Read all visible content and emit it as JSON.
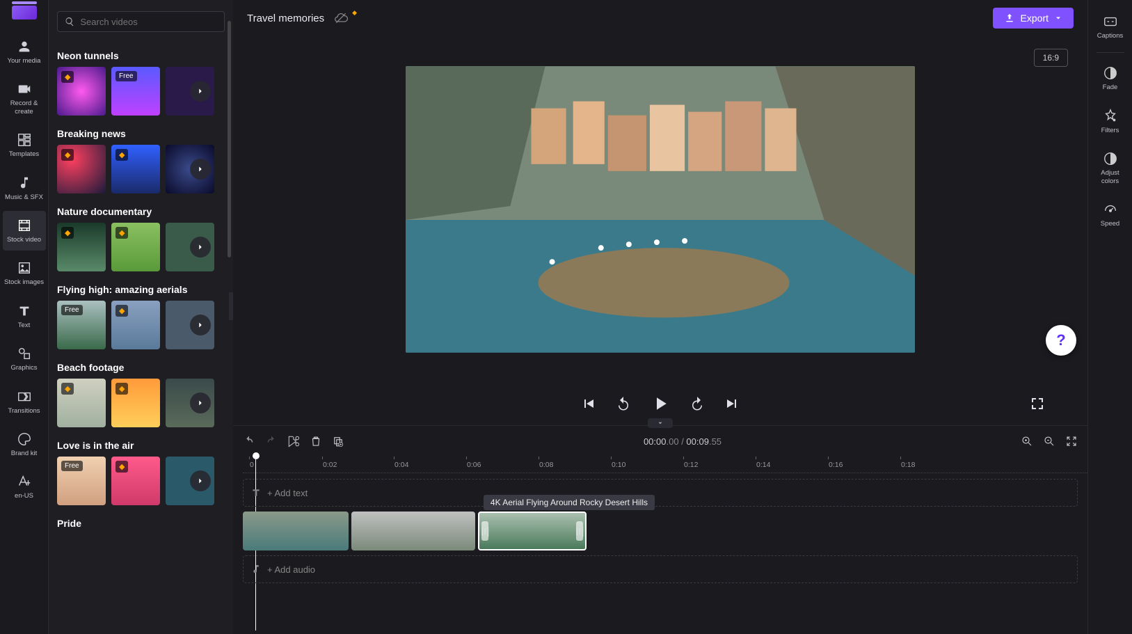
{
  "search": {
    "placeholder": "Search videos"
  },
  "nav": {
    "your_media": "Your media",
    "record_create": "Record & create",
    "templates": "Templates",
    "music_sfx": "Music & SFX",
    "stock_video": "Stock video",
    "stock_images": "Stock images",
    "text": "Text",
    "graphics": "Graphics",
    "transitions": "Transitions",
    "brand_kit": "Brand kit",
    "locale": "en-US"
  },
  "categories": {
    "neon": "Neon tunnels",
    "breaking": "Breaking news",
    "nature": "Nature documentary",
    "flying": "Flying high: amazing aerials",
    "beach": "Beach footage",
    "love": "Love is in the air",
    "pride": "Pride"
  },
  "badges": {
    "free": "Free"
  },
  "project": {
    "name": "Travel memories"
  },
  "export": {
    "label": "Export"
  },
  "aspect": {
    "label": "16:9"
  },
  "rightbar": {
    "captions": "Captions",
    "fade": "Fade",
    "filters": "Filters",
    "adjust": "Adjust colors",
    "speed": "Speed"
  },
  "timeline": {
    "current": "00:00",
    "current_frac": ".00",
    "sep": " / ",
    "total": "00:09",
    "total_frac": ".55",
    "ticks": [
      "0",
      "0:02",
      "0:04",
      "0:06",
      "0:08",
      "0:10",
      "0:12",
      "0:14",
      "0:16",
      "0:18"
    ],
    "add_text": "+ Add text",
    "add_audio": "+ Add audio",
    "clip_tooltip": "4K Aerial Flying Around Rocky Desert Hills"
  }
}
